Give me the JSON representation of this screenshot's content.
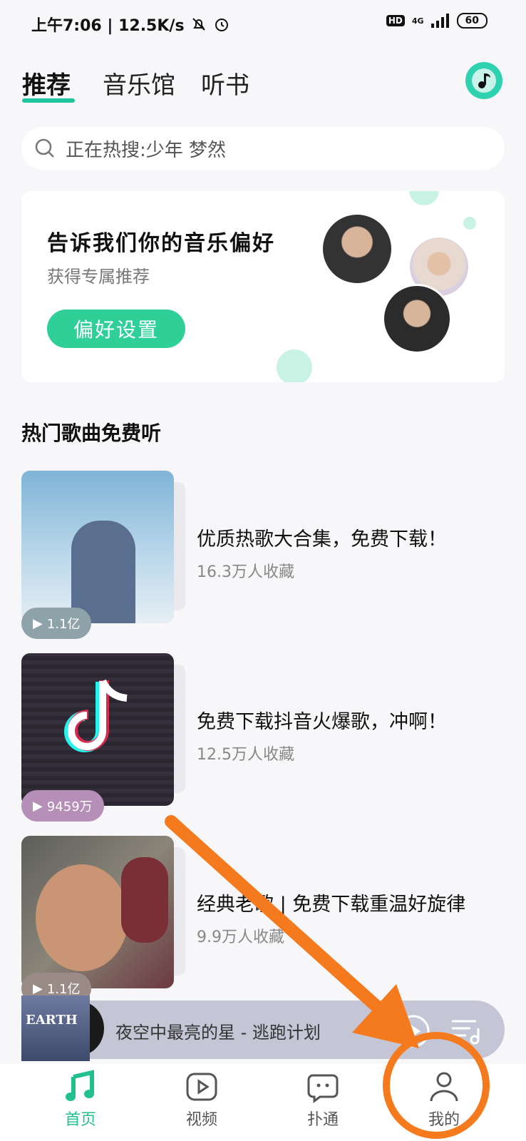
{
  "status_bar": {
    "time_speed": "上午7:06 | 12.5K/s",
    "hd": "HD",
    "network": "4G",
    "battery": "60"
  },
  "tabs": [
    {
      "label": "推荐",
      "active": true
    },
    {
      "label": "音乐馆",
      "active": false
    },
    {
      "label": "听书",
      "active": false
    }
  ],
  "search": {
    "placeholder": "正在热搜:少年 梦然"
  },
  "preference_card": {
    "title": "告诉我们你的音乐偏好",
    "subtitle": "获得专属推荐",
    "button": "偏好设置"
  },
  "section_title": "热门歌曲免费听",
  "playlists": [
    {
      "title": "优质热歌大合集，免费下载！",
      "collect": "16.3万人收藏",
      "plays": "1.1亿"
    },
    {
      "title": "免费下载抖音火爆歌，冲啊！",
      "collect": "12.5万人收藏",
      "plays": "9459万"
    },
    {
      "title": "经典老歌 | 免费下载重温好旋律",
      "collect": "9.9万人收藏",
      "plays": "1.1亿"
    }
  ],
  "mini_player": {
    "cover_text": "EARTH",
    "song": "夜空中最亮的星 - 逃跑计划"
  },
  "bottom_nav": [
    {
      "label": "首页",
      "icon": "music-note-icon",
      "active": true
    },
    {
      "label": "视频",
      "icon": "video-play-icon",
      "active": false
    },
    {
      "label": "扑通",
      "icon": "chat-bubble-icon",
      "active": false
    },
    {
      "label": "我的",
      "icon": "profile-icon",
      "active": false
    }
  ],
  "colors": {
    "accent": "#22c08f",
    "annotation": "#f57a1e"
  }
}
